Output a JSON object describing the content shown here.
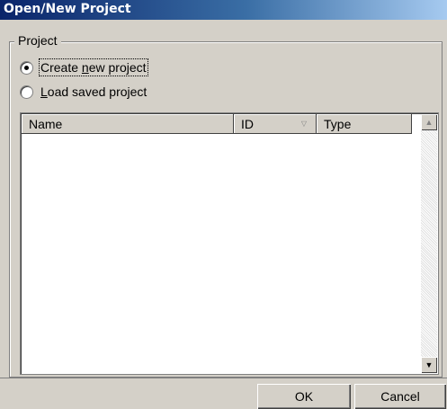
{
  "window": {
    "title": "Open/New Project"
  },
  "group": {
    "label": "Project"
  },
  "options": [
    {
      "label": "Create new project",
      "checked": true
    },
    {
      "label": "Load saved project",
      "checked": false
    }
  ],
  "list": {
    "columns": [
      {
        "label": "Name"
      },
      {
        "label": "ID",
        "sort_icon": "sort-descending-icon"
      },
      {
        "label": "Type"
      }
    ],
    "rows": []
  },
  "buttons": {
    "ok": "OK",
    "cancel": "Cancel"
  }
}
